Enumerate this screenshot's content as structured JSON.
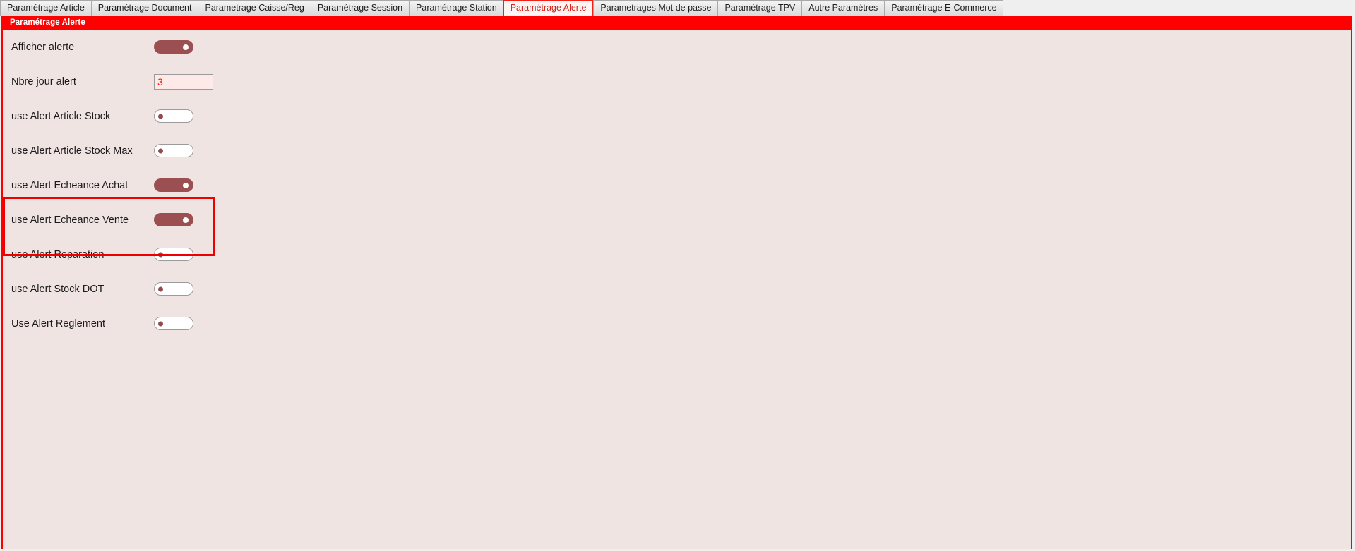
{
  "tabs": [
    {
      "label": "Paramétrage Article",
      "active": false
    },
    {
      "label": "Paramétrage Document",
      "active": false
    },
    {
      "label": "Parametrage Caisse/Reg",
      "active": false
    },
    {
      "label": "Paramétrage Session",
      "active": false
    },
    {
      "label": "Paramétrage Station",
      "active": false
    },
    {
      "label": "Paramétrage Alerte",
      "active": true
    },
    {
      "label": "Parametrages Mot de passe",
      "active": false
    },
    {
      "label": "Paramétrage TPV",
      "active": false
    },
    {
      "label": "Autre Paramétres",
      "active": false
    },
    {
      "label": "Paramétrage E-Commerce",
      "active": false
    }
  ],
  "panel": {
    "title": "Paramétrage Alerte",
    "border_color": "#ff0000",
    "background_color": "#f0e4e3",
    "title_background": "#ff0000",
    "title_color": "#ffffff"
  },
  "settings": [
    {
      "label": "Afficher alerte",
      "control": "toggle",
      "state": "on"
    },
    {
      "label": "Nbre jour alert",
      "control": "textbox",
      "value": "3",
      "placeholder": ""
    },
    {
      "label": "use Alert Article Stock",
      "control": "toggle",
      "state": "off"
    },
    {
      "label": "use Alert Article Stock Max",
      "control": "toggle",
      "state": "off"
    },
    {
      "label": "use Alert Echeance Achat",
      "control": "toggle",
      "state": "on"
    },
    {
      "label": "use Alert Echeance Vente",
      "control": "toggle",
      "state": "on"
    },
    {
      "label": "use Alert Reparation",
      "control": "toggle",
      "state": "off"
    },
    {
      "label": "use Alert Stock DOT",
      "control": "toggle",
      "state": "off"
    },
    {
      "label": "Use Alert Reglement",
      "control": "toggle",
      "state": "off"
    }
  ],
  "annotation": {
    "type": "highlight-rectangle",
    "color": "#ee0000",
    "targets": [
      "use Alert Echeance Achat",
      "use Alert Echeance Vente"
    ]
  },
  "colors": {
    "toggle_on": "#9c4f50",
    "toggle_off_border": "#9b9b9b",
    "toggle_off_dot": "#95494a",
    "input_text": "#ff1100",
    "input_background": "#fde9e7",
    "accent_red": "#ff0000",
    "active_tab_text": "#d5241b"
  }
}
